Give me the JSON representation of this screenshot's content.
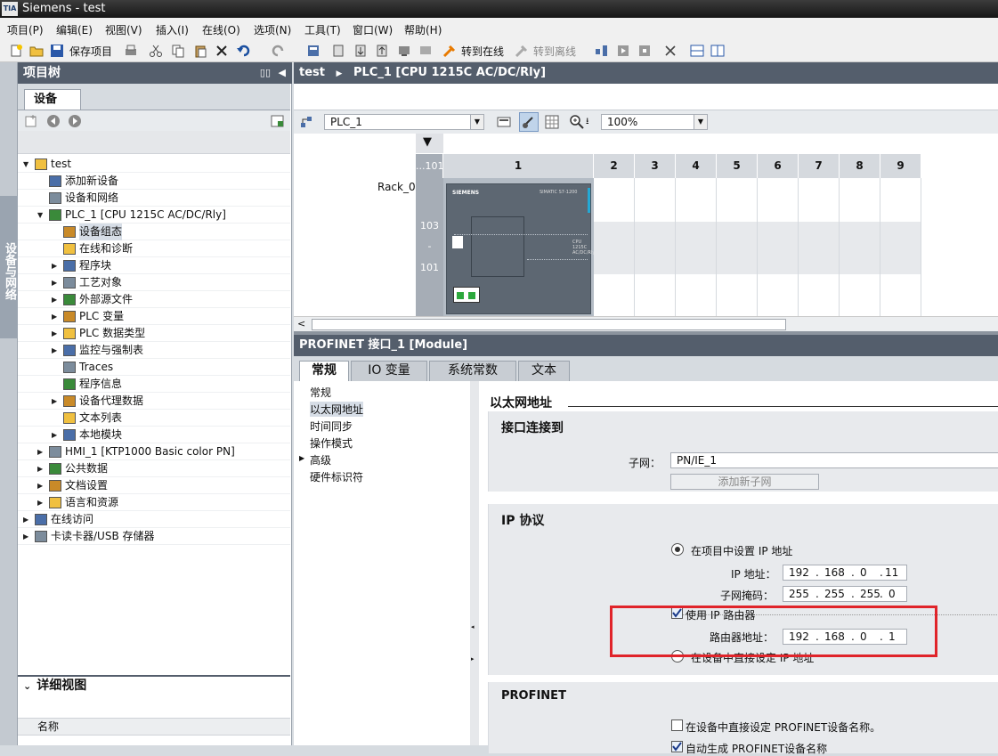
{
  "window": {
    "title": "Siemens  -  test",
    "logo_text": "TIA"
  },
  "menu": [
    "项目(P)",
    "编辑(E)",
    "视图(V)",
    "插入(I)",
    "在线(O)",
    "选项(N)",
    "工具(T)",
    "窗口(W)",
    "帮助(H)"
  ],
  "toolbar": {
    "save_label": "保存项目",
    "go_online": "转到在线",
    "go_offline": "转到离线"
  },
  "side_tab": "设备与网络",
  "project_tree": {
    "title": "项目树",
    "tab": "设备",
    "items": [
      {
        "label": "test",
        "level": 0,
        "expand": "down"
      },
      {
        "label": "添加新设备",
        "level": 1,
        "expand": ""
      },
      {
        "label": "设备和网络",
        "level": 1,
        "expand": ""
      },
      {
        "label": "PLC_1 [CPU 1215C AC/DC/Rly]",
        "level": 1,
        "expand": "down"
      },
      {
        "label": "设备组态",
        "level": 2,
        "expand": "",
        "selected": true
      },
      {
        "label": "在线和诊断",
        "level": 2,
        "expand": ""
      },
      {
        "label": "程序块",
        "level": 2,
        "expand": "right"
      },
      {
        "label": "工艺对象",
        "level": 2,
        "expand": "right"
      },
      {
        "label": "外部源文件",
        "level": 2,
        "expand": "right"
      },
      {
        "label": "PLC 变量",
        "level": 2,
        "expand": "right"
      },
      {
        "label": "PLC 数据类型",
        "level": 2,
        "expand": "right"
      },
      {
        "label": "监控与强制表",
        "level": 2,
        "expand": "right"
      },
      {
        "label": "Traces",
        "level": 2,
        "expand": ""
      },
      {
        "label": "程序信息",
        "level": 2,
        "expand": ""
      },
      {
        "label": "设备代理数据",
        "level": 2,
        "expand": "right"
      },
      {
        "label": "文本列表",
        "level": 2,
        "expand": ""
      },
      {
        "label": "本地模块",
        "level": 2,
        "expand": "right"
      },
      {
        "label": "HMI_1 [KTP1000 Basic color PN]",
        "level": 1,
        "expand": "right"
      },
      {
        "label": "公共数据",
        "level": 1,
        "expand": "right"
      },
      {
        "label": "文档设置",
        "level": 1,
        "expand": "right"
      },
      {
        "label": "语言和资源",
        "level": 1,
        "expand": "right"
      },
      {
        "label": "在线访问",
        "level": 0,
        "expand": "right"
      },
      {
        "label": "卡读卡器/USB 存储器",
        "level": 0,
        "expand": "right"
      }
    ],
    "detail_title": "详细视图",
    "detail_col": "名称"
  },
  "breadcrumb": {
    "project": "test",
    "device": "PLC_1 [CPU 1215C AC/DC/Rly]"
  },
  "device_view": {
    "device_select": "PLC_1",
    "zoom": "100%",
    "rack": "Rack_0",
    "slot_labels": [
      "...101",
      "1",
      "2",
      "3",
      "4",
      "5",
      "6",
      "7",
      "8",
      "9"
    ],
    "row_labels": [
      "103",
      "-",
      "101"
    ],
    "cpu_brand": "SIEMENS",
    "cpu_model": "SIMATIC S7-1200",
    "cpu_text": "CPU 1215C AC/DC/Rly"
  },
  "properties": {
    "title": "PROFINET 接口_1 [Module]",
    "tabs": [
      "常规",
      "IO 变量",
      "系统常数",
      "文本"
    ],
    "nav": [
      "常规",
      "以太网地址",
      "时间同步",
      "操作模式",
      "高级",
      "硬件标识符"
    ],
    "ethernet_title": "以太网地址",
    "connected_title": "接口连接到",
    "subnet_label": "子网：",
    "subnet_value": "PN/IE_1",
    "add_subnet": "添加新子网",
    "ip_title": "IP 协议",
    "set_in_project": "在项目中设置 IP 地址",
    "ip_label": "IP 地址：",
    "ip": [
      "192",
      "168",
      "0",
      "11"
    ],
    "mask_label": "子网掩码：",
    "mask": [
      "255",
      "255",
      "255",
      "0"
    ],
    "use_router": "使用 IP 路由器",
    "router_label": "路由器地址：",
    "router": [
      "192",
      "168",
      "0",
      "1"
    ],
    "set_on_device": "在设备中直接设定 IP 地址",
    "profinet_title": "PROFINET",
    "pn_name_direct": "在设备中直接设定 PROFINET设备名称。",
    "pn_name_auto": "自动生成 PROFINET设备名称"
  },
  "colors": {
    "header": "#545e6c",
    "highlight_box": "#e0242a"
  }
}
